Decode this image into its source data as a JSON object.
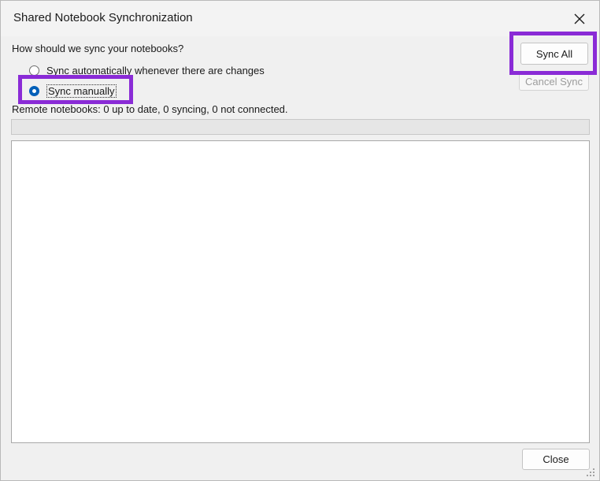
{
  "window": {
    "title": "Shared Notebook Synchronization"
  },
  "sync": {
    "question": "How should we sync your notebooks?",
    "options": [
      {
        "label": "Sync automatically whenever there are changes",
        "selected": false
      },
      {
        "label": "Sync manually",
        "selected": true
      }
    ],
    "status": "Remote notebooks: 0 up to date, 0 syncing, 0 not connected."
  },
  "buttons": {
    "sync_all": "Sync All",
    "cancel_sync": "Cancel Sync",
    "close": "Close"
  },
  "colors": {
    "highlight": "#8a2bd6",
    "radio_accent": "#005fb8"
  },
  "icons": {
    "close": "close-icon",
    "resize": "resize-grip-icon"
  }
}
